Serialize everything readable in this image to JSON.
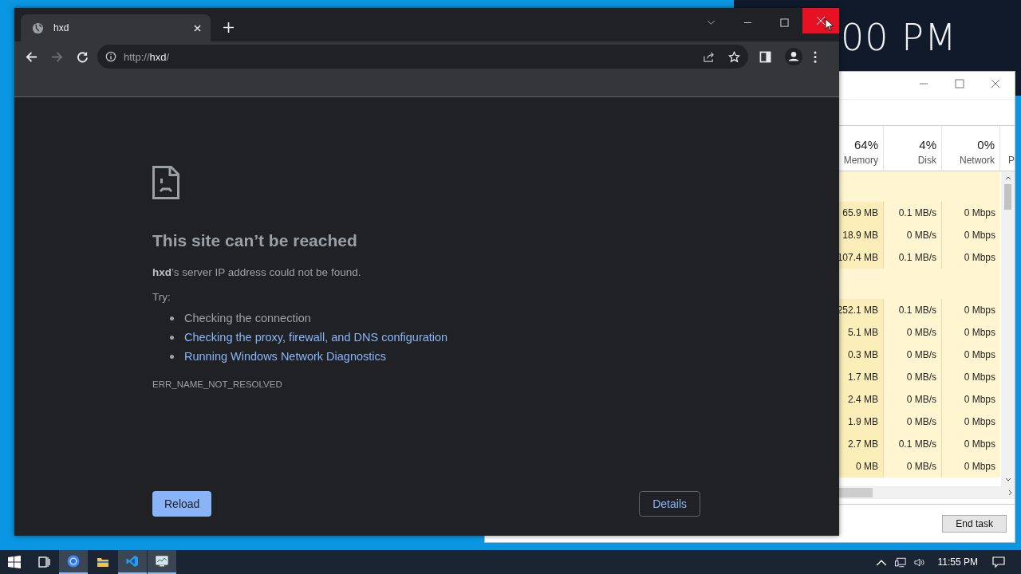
{
  "desktop": {
    "clock_fragment": "00 PM"
  },
  "browser": {
    "tabs": [
      {
        "title": "hxd",
        "selected": true
      }
    ],
    "url": {
      "scheme": "http://",
      "host": "hxd",
      "path": "/"
    },
    "forward_disabled": true,
    "close_hovered": true,
    "error": {
      "title": "This site can’t be reached",
      "message": "**hxd**’s server IP address could not be found.",
      "try_label": "Try:",
      "suggestions": [
        {
          "kind": "text",
          "text": "Checking the connection"
        },
        {
          "kind": "link",
          "text": "Checking the proxy, firewall, and DNS configuration"
        },
        {
          "kind": "link",
          "text": "Running Windows Network Diagnostics"
        }
      ],
      "code": "ERR_NAME_NOT_RESOLVED",
      "reload": "Reload",
      "details": "Details"
    }
  },
  "task_manager": {
    "columns": [
      {
        "value": "64%",
        "label": "Memory"
      },
      {
        "value": "4%",
        "label": "Disk"
      },
      {
        "value": "0%",
        "label": "Network"
      }
    ],
    "column_4": "P",
    "rows": [
      {
        "kind": "group"
      },
      {
        "kind": "process",
        "cells": [
          "65.9 MB",
          "0.1 MB/s",
          "0 Mbps"
        ]
      },
      {
        "kind": "process",
        "cells": [
          "18.9 MB",
          "0 MB/s",
          "0 Mbps"
        ]
      },
      {
        "kind": "process",
        "cells": [
          "107.4 MB",
          "0.1 MB/s",
          "0 Mbps"
        ]
      },
      {
        "kind": "group"
      },
      {
        "kind": "process",
        "cells": [
          "252.1 MB",
          "0.1 MB/s",
          "0 Mbps"
        ]
      },
      {
        "kind": "process",
        "cells": [
          "5.1 MB",
          "0 MB/s",
          "0 Mbps"
        ]
      },
      {
        "kind": "process",
        "cells": [
          "0.3 MB",
          "0 MB/s",
          "0 Mbps"
        ]
      },
      {
        "kind": "process",
        "cells": [
          "1.7 MB",
          "0 MB/s",
          "0 Mbps"
        ]
      },
      {
        "kind": "process",
        "cells": [
          "2.4 MB",
          "0 MB/s",
          "0 Mbps"
        ]
      },
      {
        "kind": "process",
        "cells": [
          "1.9 MB",
          "0 MB/s",
          "0 Mbps"
        ]
      },
      {
        "kind": "process",
        "cells": [
          "2.7 MB",
          "0.1 MB/s",
          "0 Mbps"
        ]
      },
      {
        "kind": "process",
        "cells": [
          "0 MB",
          "0 MB/s",
          "0 Mbps"
        ]
      }
    ],
    "end_task": "End task"
  },
  "taskbar": {
    "buttons": [
      {
        "kind": "start",
        "open": false
      },
      {
        "kind": "task-view",
        "open": false
      },
      {
        "kind": "browser",
        "open": true
      },
      {
        "kind": "folder",
        "open": false
      },
      {
        "kind": "editor",
        "open": true
      },
      {
        "kind": "monitor",
        "open": true
      }
    ],
    "time": "11:55 PM"
  }
}
